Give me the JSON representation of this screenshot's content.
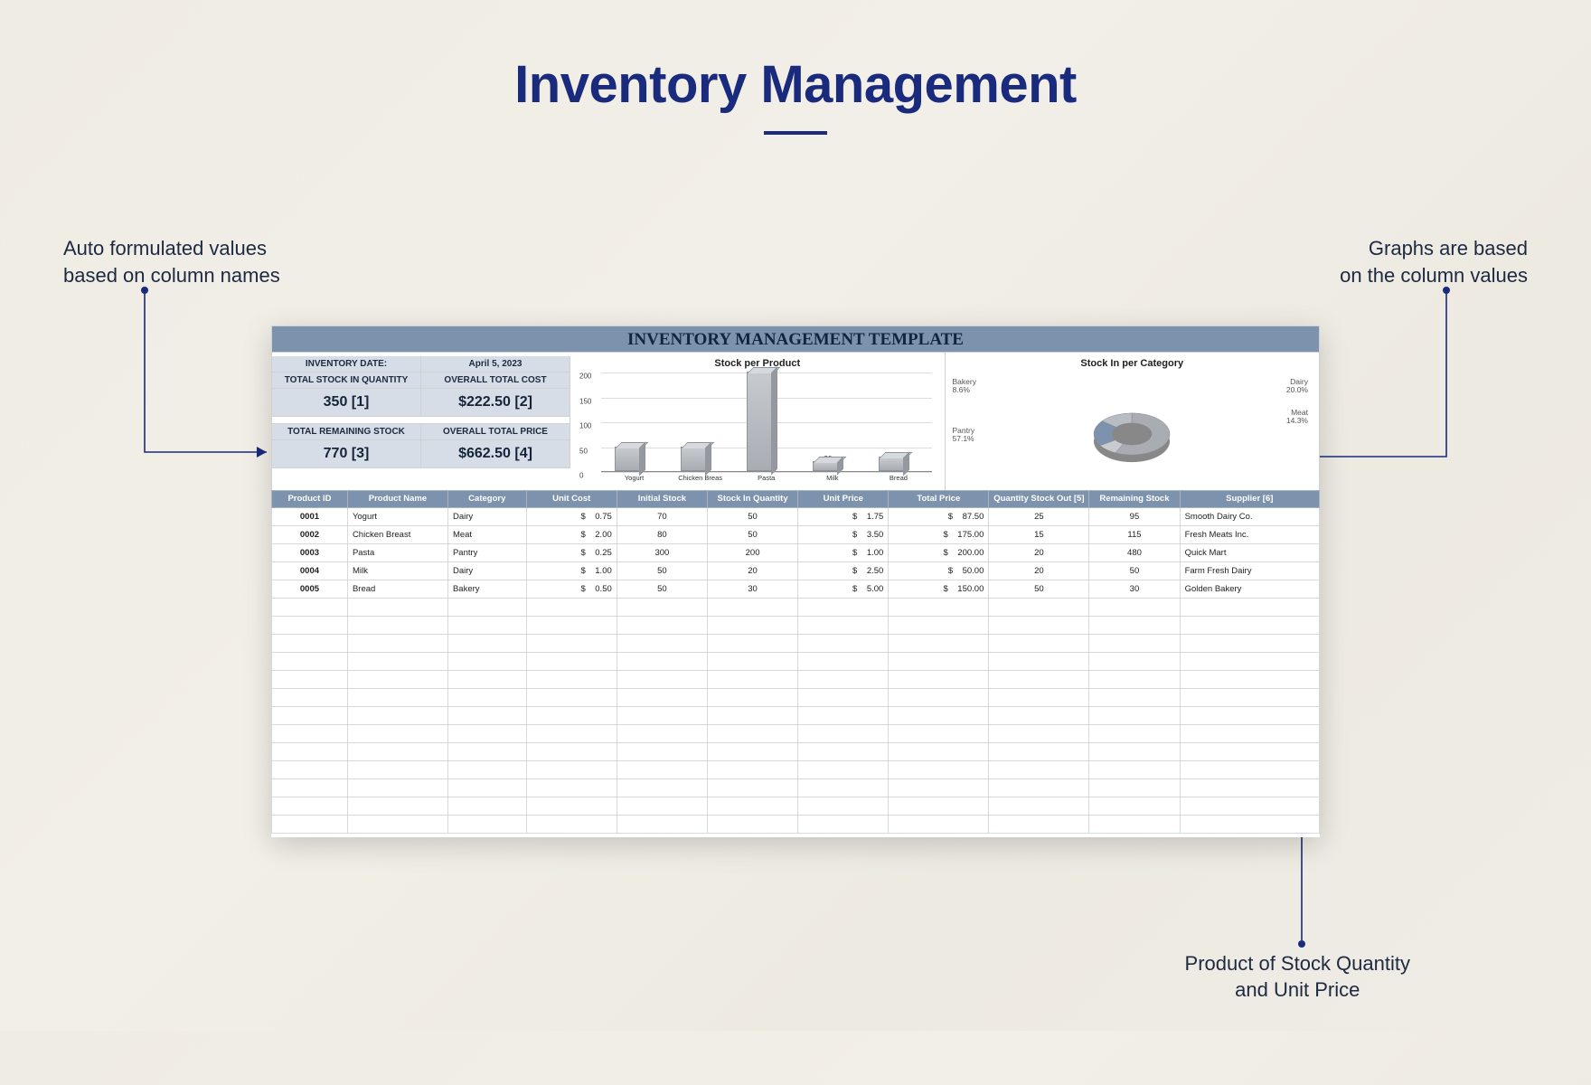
{
  "page": {
    "title": "Inventory Management"
  },
  "annotations": {
    "left": "Auto formulated values\nbased on column names",
    "right": "Graphs are based\non the column values",
    "bottom": "Product of Stock Quantity\nand Unit Price"
  },
  "sheet": {
    "banner": "INVENTORY MANAGEMENT TEMPLATE",
    "summary": {
      "date_label": "INVENTORY DATE:",
      "date_value": "April 5, 2023",
      "stock_in_label": "TOTAL STOCK IN QUANTITY",
      "stock_in_value": "350 [1]",
      "total_cost_label": "OVERALL TOTAL COST",
      "total_cost_value": "$222.50 [2]",
      "remaining_label": "TOTAL REMAINING STOCK",
      "remaining_value": "770 [3]",
      "total_price_label": "OVERALL TOTAL PRICE",
      "total_price_value": "$662.50 [4]"
    },
    "headers": {
      "c1": "Product ID",
      "c2": "Product Name",
      "c3": "Category",
      "c4": "Unit Cost",
      "c5": "Initial Stock",
      "c6": "Stock In Quantity",
      "c7": "Unit Price",
      "c8": "Total Price",
      "c9": "Quantity Stock Out [5]",
      "c10": "Remaining Stock",
      "c11": "Supplier [6]"
    },
    "rows": [
      {
        "id": "0001",
        "name": "Yogurt",
        "cat": "Dairy",
        "ucost": "0.75",
        "istock": "70",
        "sin": "50",
        "uprice": "1.75",
        "tprice": "87.50",
        "sout": "25",
        "rem": "95",
        "supp": "Smooth Dairy Co."
      },
      {
        "id": "0002",
        "name": "Chicken Breast",
        "cat": "Meat",
        "ucost": "2.00",
        "istock": "80",
        "sin": "50",
        "uprice": "3.50",
        "tprice": "175.00",
        "sout": "15",
        "rem": "115",
        "supp": "Fresh Meats Inc."
      },
      {
        "id": "0003",
        "name": "Pasta",
        "cat": "Pantry",
        "ucost": "0.25",
        "istock": "300",
        "sin": "200",
        "uprice": "1.00",
        "tprice": "200.00",
        "sout": "20",
        "rem": "480",
        "supp": "Quick Mart"
      },
      {
        "id": "0004",
        "name": "Milk",
        "cat": "Dairy",
        "ucost": "1.00",
        "istock": "50",
        "sin": "20",
        "uprice": "2.50",
        "tprice": "50.00",
        "sout": "20",
        "rem": "50",
        "supp": "Farm Fresh Dairy"
      },
      {
        "id": "0005",
        "name": "Bread",
        "cat": "Bakery",
        "ucost": "0.50",
        "istock": "50",
        "sin": "30",
        "uprice": "5.00",
        "tprice": "150.00",
        "sout": "50",
        "rem": "30",
        "supp": "Golden Bakery"
      }
    ]
  },
  "chart_data": [
    {
      "type": "bar",
      "title": "Stock per Product",
      "categories": [
        "Yogurt",
        "Chicken Breast",
        "Pasta",
        "Milk",
        "Bread"
      ],
      "values": [
        50,
        50,
        200,
        20,
        30
      ],
      "ylabel": "",
      "xlabel": "",
      "ylim": [
        0,
        200
      ],
      "yticks": [
        0,
        50,
        100,
        150,
        200
      ]
    },
    {
      "type": "pie",
      "title": "Stock In per Category",
      "series": [
        {
          "name": "Pantry",
          "value": 57.1,
          "color": "#a9adb3"
        },
        {
          "name": "Bakery",
          "value": 8.6,
          "color": "#c7cacf"
        },
        {
          "name": "Dairy",
          "value": 20.0,
          "color": "#7c92ad"
        },
        {
          "name": "Meat",
          "value": 14.3,
          "color": "#b8bdc4"
        }
      ]
    }
  ]
}
